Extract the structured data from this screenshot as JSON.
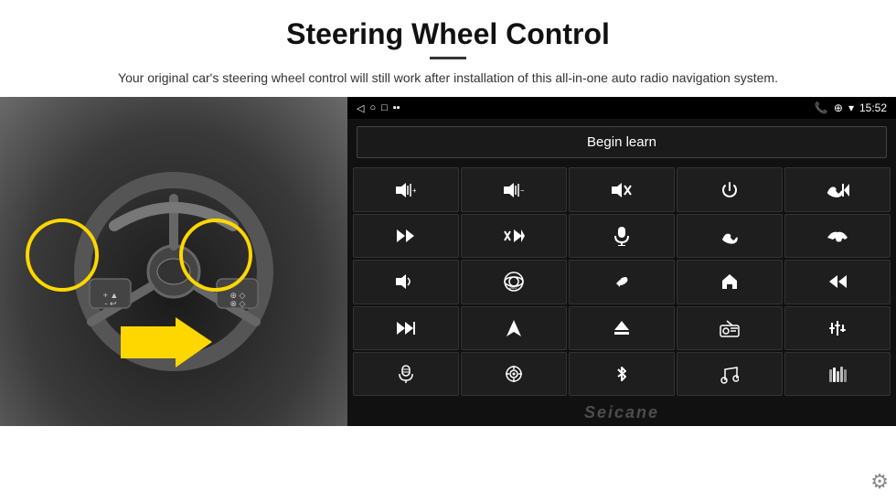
{
  "header": {
    "title": "Steering Wheel Control",
    "divider": true,
    "subtitle": "Your original car's steering wheel control will still work after installation of this all-in-one auto radio navigation system."
  },
  "status_bar": {
    "left_icons": [
      "◁",
      "○",
      "□",
      "▪▪"
    ],
    "time": "15:52",
    "right_icons": [
      "📞",
      "⊕",
      "▼"
    ]
  },
  "begin_learn": {
    "label": "Begin learn"
  },
  "controls": [
    {
      "icon": "🔊+",
      "label": "vol-up"
    },
    {
      "icon": "🔊-",
      "label": "vol-down"
    },
    {
      "icon": "🔇",
      "label": "mute"
    },
    {
      "icon": "⏻",
      "label": "power"
    },
    {
      "icon": "📞⏮",
      "label": "phone-prev"
    },
    {
      "icon": "⏭",
      "label": "next-track"
    },
    {
      "icon": "✕⏭",
      "label": "skip"
    },
    {
      "icon": "🎤",
      "label": "mic"
    },
    {
      "icon": "📞",
      "label": "call"
    },
    {
      "icon": "↩",
      "label": "hang-up"
    },
    {
      "icon": "🔈",
      "label": "speaker"
    },
    {
      "icon": "🔄360",
      "label": "360-camera"
    },
    {
      "icon": "↩",
      "label": "back"
    },
    {
      "icon": "🏠",
      "label": "home"
    },
    {
      "icon": "⏮⏮",
      "label": "prev-track"
    },
    {
      "icon": "⏭⏭",
      "label": "fast-forward"
    },
    {
      "icon": "▶",
      "label": "navigate"
    },
    {
      "icon": "⏏",
      "label": "eject"
    },
    {
      "icon": "📻",
      "label": "radio"
    },
    {
      "icon": "⚙",
      "label": "settings-eq"
    },
    {
      "icon": "🎤",
      "label": "mic2"
    },
    {
      "icon": "🎯",
      "label": "target"
    },
    {
      "icon": "✱",
      "label": "bluetooth"
    },
    {
      "icon": "🎵",
      "label": "music"
    },
    {
      "icon": "📊",
      "label": "equalizer"
    }
  ],
  "watermark": "Seicane",
  "gear_icon": "⚙"
}
